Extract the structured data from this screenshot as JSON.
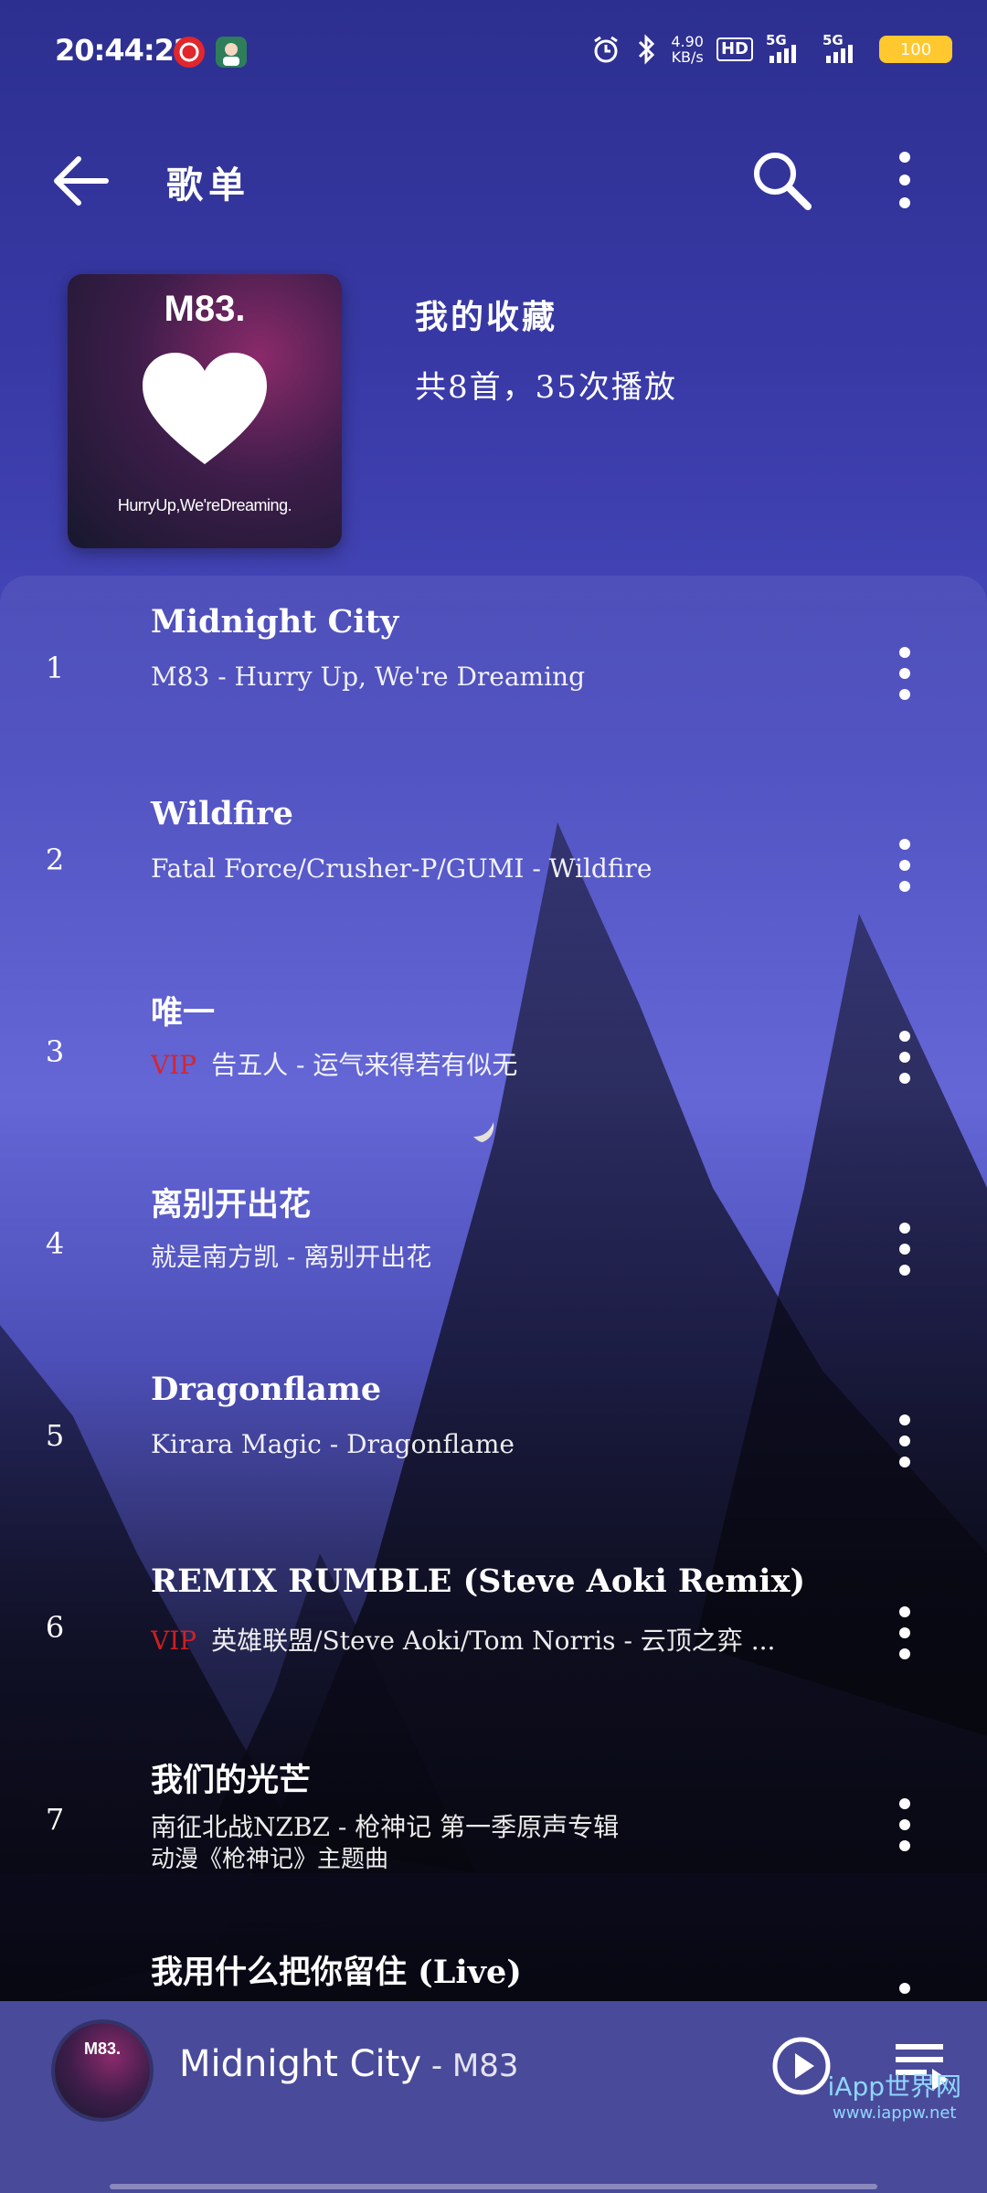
{
  "status_bar": {
    "time": "20:44:22",
    "netspeed_value": "4.90",
    "netspeed_unit": "KB/s",
    "hd": "HD",
    "signal1": "5G",
    "signal2": "5G",
    "battery": "100",
    "app_icon_1": "netease-music-icon",
    "app_icon_2": "avatar-app-icon"
  },
  "app_bar": {
    "title": "歌单",
    "back_icon": "arrow-left-icon",
    "search_icon": "search-icon",
    "more_icon": "more-vertical-icon"
  },
  "playlist": {
    "cover_band": "M83.",
    "cover_album": "HurryUp,We'reDreaming.",
    "name": "我的收藏",
    "stats": "共8首，35次播放"
  },
  "songs": [
    {
      "index": "1",
      "title": "Midnight City",
      "vip": "",
      "subtitle": "M83 - Hurry Up, We're Dreaming"
    },
    {
      "index": "2",
      "title": "Wildfire",
      "vip": "",
      "subtitle": "Fatal Force/Crusher-P/GUMI - Wildfire"
    },
    {
      "index": "3",
      "title": "唯一",
      "vip": "VIP",
      "subtitle": "告五人 - 运气来得若有似无"
    },
    {
      "index": "4",
      "title": "离别开出花",
      "vip": "",
      "subtitle": "就是南方凯 - 离别开出花"
    },
    {
      "index": "5",
      "title": "Dragonflame",
      "vip": "",
      "subtitle": "Kirara Magic - Dragonflame"
    },
    {
      "index": "6",
      "title": "REMIX RUMBLE (Steve Aoki Remix)",
      "vip": "VIP",
      "subtitle": "英雄联盟/Steve Aoki/Tom Norris - 云顶之弈 ..."
    },
    {
      "index": "7",
      "title": "我们的光芒",
      "vip": "",
      "subtitle": "南征北战NZBZ - 枪神记 第一季原声专辑",
      "subtitle2": "动漫《枪神记》主题曲"
    },
    {
      "index": "",
      "title": "我用什么把你留住 (Live)",
      "vip": "",
      "subtitle": ""
    }
  ],
  "mini_player": {
    "cover_text": "M83.",
    "title": "Midnight City",
    "artist": " - M83",
    "play_icon": "play-circle-icon",
    "queue_icon": "playlist-queue-icon"
  },
  "watermark": {
    "line1": "iApp世界网",
    "line2": "www.iappw.net"
  },
  "colors": {
    "vip": "#e02020",
    "battery": "#ffc82e",
    "mini_player_bg": "#4a4a9a"
  }
}
